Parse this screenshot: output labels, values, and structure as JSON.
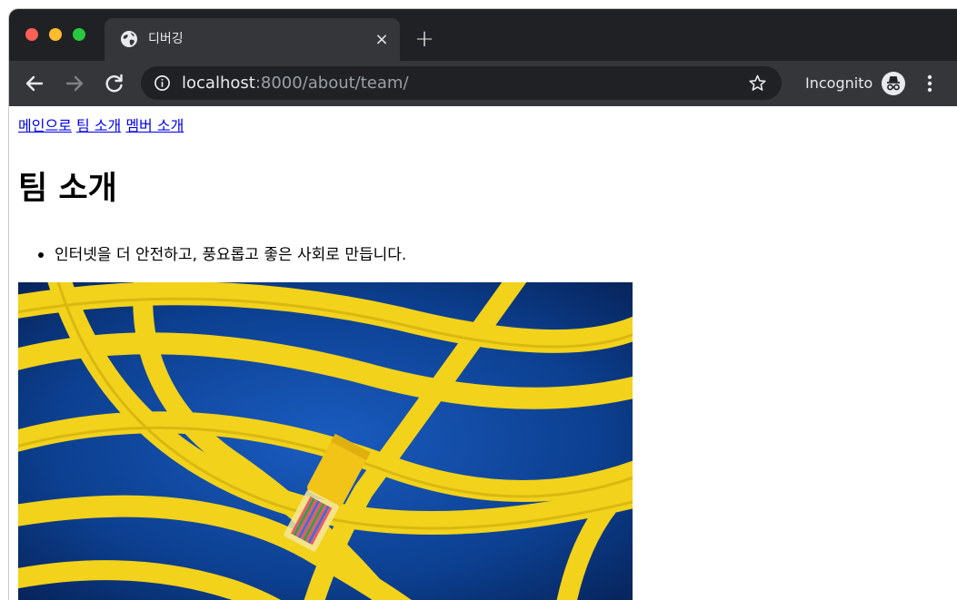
{
  "browser": {
    "tab": {
      "title": "디버깅",
      "close_glyph": "×"
    },
    "new_tab_glyph": "+",
    "url": {
      "host": "localhost",
      "path": ":8000/about/team/"
    },
    "incognito_label": "Incognito"
  },
  "page": {
    "nav_links": [
      "메인으로",
      "팀 소개",
      "멤버 소개"
    ],
    "title": "팀 소개",
    "mission": "인터넷을 더 안전하고, 풍요롭고 좋은 사회로 만듭니다."
  },
  "icons": {
    "favicon": "globe-icon",
    "back": "arrow-left-icon",
    "forward": "arrow-right-icon",
    "reload": "reload-icon",
    "site_info": "info-icon",
    "bookmark": "star-icon",
    "incognito": "incognito-icon",
    "menu": "kebab-menu-icon"
  },
  "colors": {
    "tab_strip": "#202124",
    "toolbar": "#35363a",
    "link": "#0000ee",
    "image_background": "#0c3f8f",
    "cable": "#f2d21b"
  }
}
